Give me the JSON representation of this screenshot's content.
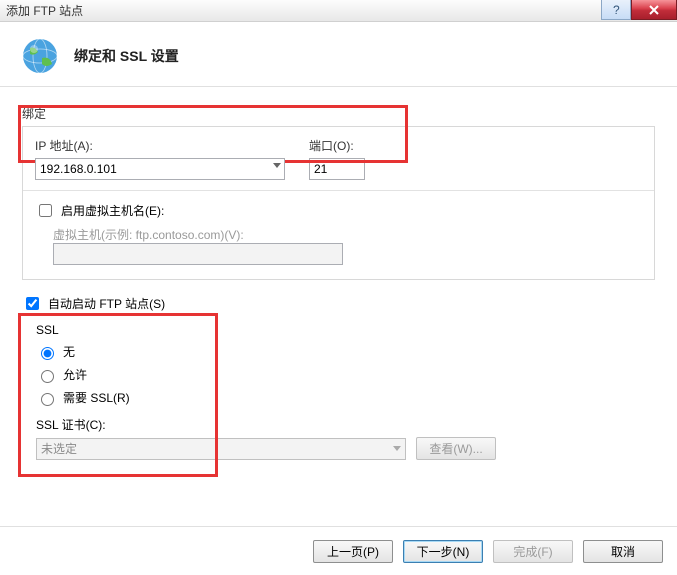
{
  "window": {
    "title": "添加 FTP 站点"
  },
  "header": {
    "title": "绑定和 SSL 设置"
  },
  "binding": {
    "group_label": "绑定",
    "ip_label": "IP 地址(A):",
    "ip_value": "192.168.0.101",
    "port_label": "端口(O):",
    "port_value": "21",
    "enable_vhost_label": "启用虚拟主机名(E):",
    "vhost_label": "虚拟主机(示例: ftp.contoso.com)(V):",
    "vhost_value": ""
  },
  "autostart": {
    "label": "自动启动 FTP 站点(S)"
  },
  "ssl": {
    "group_label": "SSL",
    "opt_none": "无",
    "opt_allow": "允许",
    "opt_require": "需要 SSL(R)",
    "cert_label": "SSL 证书(C):",
    "cert_value": "未选定",
    "view_button": "查看(W)..."
  },
  "buttons": {
    "prev": "上一页(P)",
    "next": "下一步(N)",
    "finish": "完成(F)",
    "cancel": "取消"
  }
}
